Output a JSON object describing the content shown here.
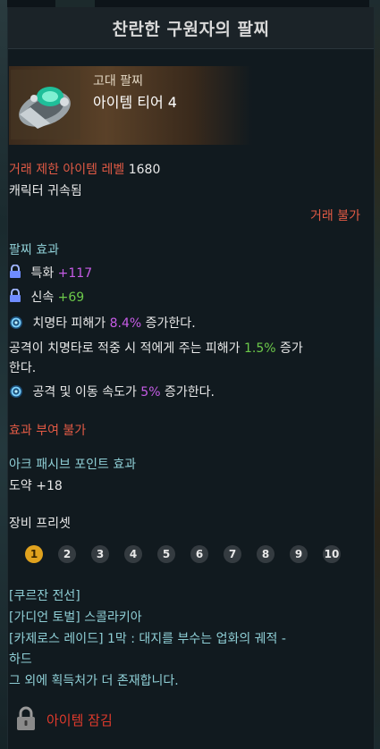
{
  "title": "찬란한 구원자의 팔찌",
  "item": {
    "grade": "고대 팔찌",
    "tier": "아이템 티어 4"
  },
  "requirements": {
    "level_label": "거래 제한 아이템 레벨",
    "level_value": "1680",
    "bound": "캐릭터 귀속됨",
    "trade": "거래 불가"
  },
  "effects": {
    "header": "팔찌 효과",
    "stat1_name": "특화",
    "stat1_value": "+117",
    "stat2_name": "신속",
    "stat2_value": "+69",
    "crit_prefix": "치명타 피해가",
    "crit_value": "8.4%",
    "crit_suffix": "증가한다.",
    "hit_prefix": "공격이 치명타로 적중 시 적에게 주는 피해가",
    "hit_value": "1.5%",
    "hit_suffix1": "증가",
    "hit_suffix2": "한다.",
    "speed_prefix": "공격 및 이동 속도가",
    "speed_value": "5%",
    "speed_suffix": "증가한다."
  },
  "enchant": "효과 부여 불가",
  "ark": {
    "header": "아크 패시브 포인트 효과",
    "value": "도약 +18"
  },
  "presets": {
    "header": "장비 프리셋",
    "items": [
      "1",
      "2",
      "3",
      "4",
      "5",
      "6",
      "7",
      "8",
      "9",
      "10"
    ],
    "active": "1"
  },
  "sources": {
    "line1": "[쿠르잔 전선]",
    "line2": "[가디언 토벌] 스콜라키아",
    "line3": "[카제로스 레이드] 1막 : 대지를 부수는 업화의 궤적 -",
    "line4": "하드",
    "line5": "그 외에 획득처가 더 존재합니다."
  },
  "lock_label": "아이템 잠김",
  "colors": {
    "red": "#e25a45",
    "purple": "#c65ce6",
    "green": "#6cc94a",
    "preset_active": "#e0a21e"
  }
}
